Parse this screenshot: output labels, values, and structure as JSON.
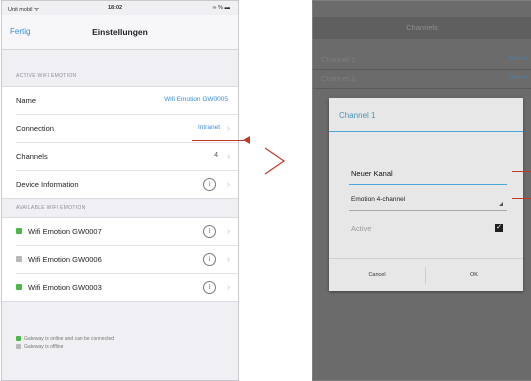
{
  "ios": {
    "status": {
      "carrier": "Unit mobil ᯤ",
      "time": "18:02",
      "battery": "∞ % ▬"
    },
    "nav": {
      "done_label": "Fertig",
      "title": "Einstellungen"
    },
    "section_active": "ACTIVE WIFI EMOTION",
    "rows": {
      "name": {
        "label": "Name",
        "value": "Wifi Emotion GW0005"
      },
      "connection": {
        "label": "Connection",
        "value": "Intranet"
      },
      "channels": {
        "label": "Channels",
        "count": "4"
      },
      "device_info": {
        "label": "Device Information"
      }
    },
    "section_available": "AVAILABLE WIFI EMOTION",
    "devices": [
      {
        "label": "Wifi Emotion GW0007",
        "status_color": "#4cb848"
      },
      {
        "label": "Wifi Emotion GW0006",
        "status_color": "#b8b8b8"
      },
      {
        "label": "Wifi Emotion GW0003",
        "status_color": "#4cb848"
      }
    ],
    "legend": {
      "online": "Gateway is online and can be connected",
      "offline": "Gateway is offline",
      "online_color": "#4cb848",
      "offline_color": "#b8b8b8"
    }
  },
  "android": {
    "header_title": "Channels",
    "list": [
      {
        "label": "Channel 1",
        "status": "Active"
      },
      {
        "label": "Channel 2",
        "status": "Active"
      }
    ],
    "dialog": {
      "title": "Channel 1",
      "name_value": "Neuer Kanal",
      "select_value": "Emotion 4-channel",
      "active_label": "Active",
      "active_checked": true,
      "cancel_label": "Cancel",
      "ok_label": "OK"
    }
  },
  "colors": {
    "accent_ios": "#3a8edb",
    "accent_android": "#4aa6d6",
    "arrow": "#c0392b"
  }
}
